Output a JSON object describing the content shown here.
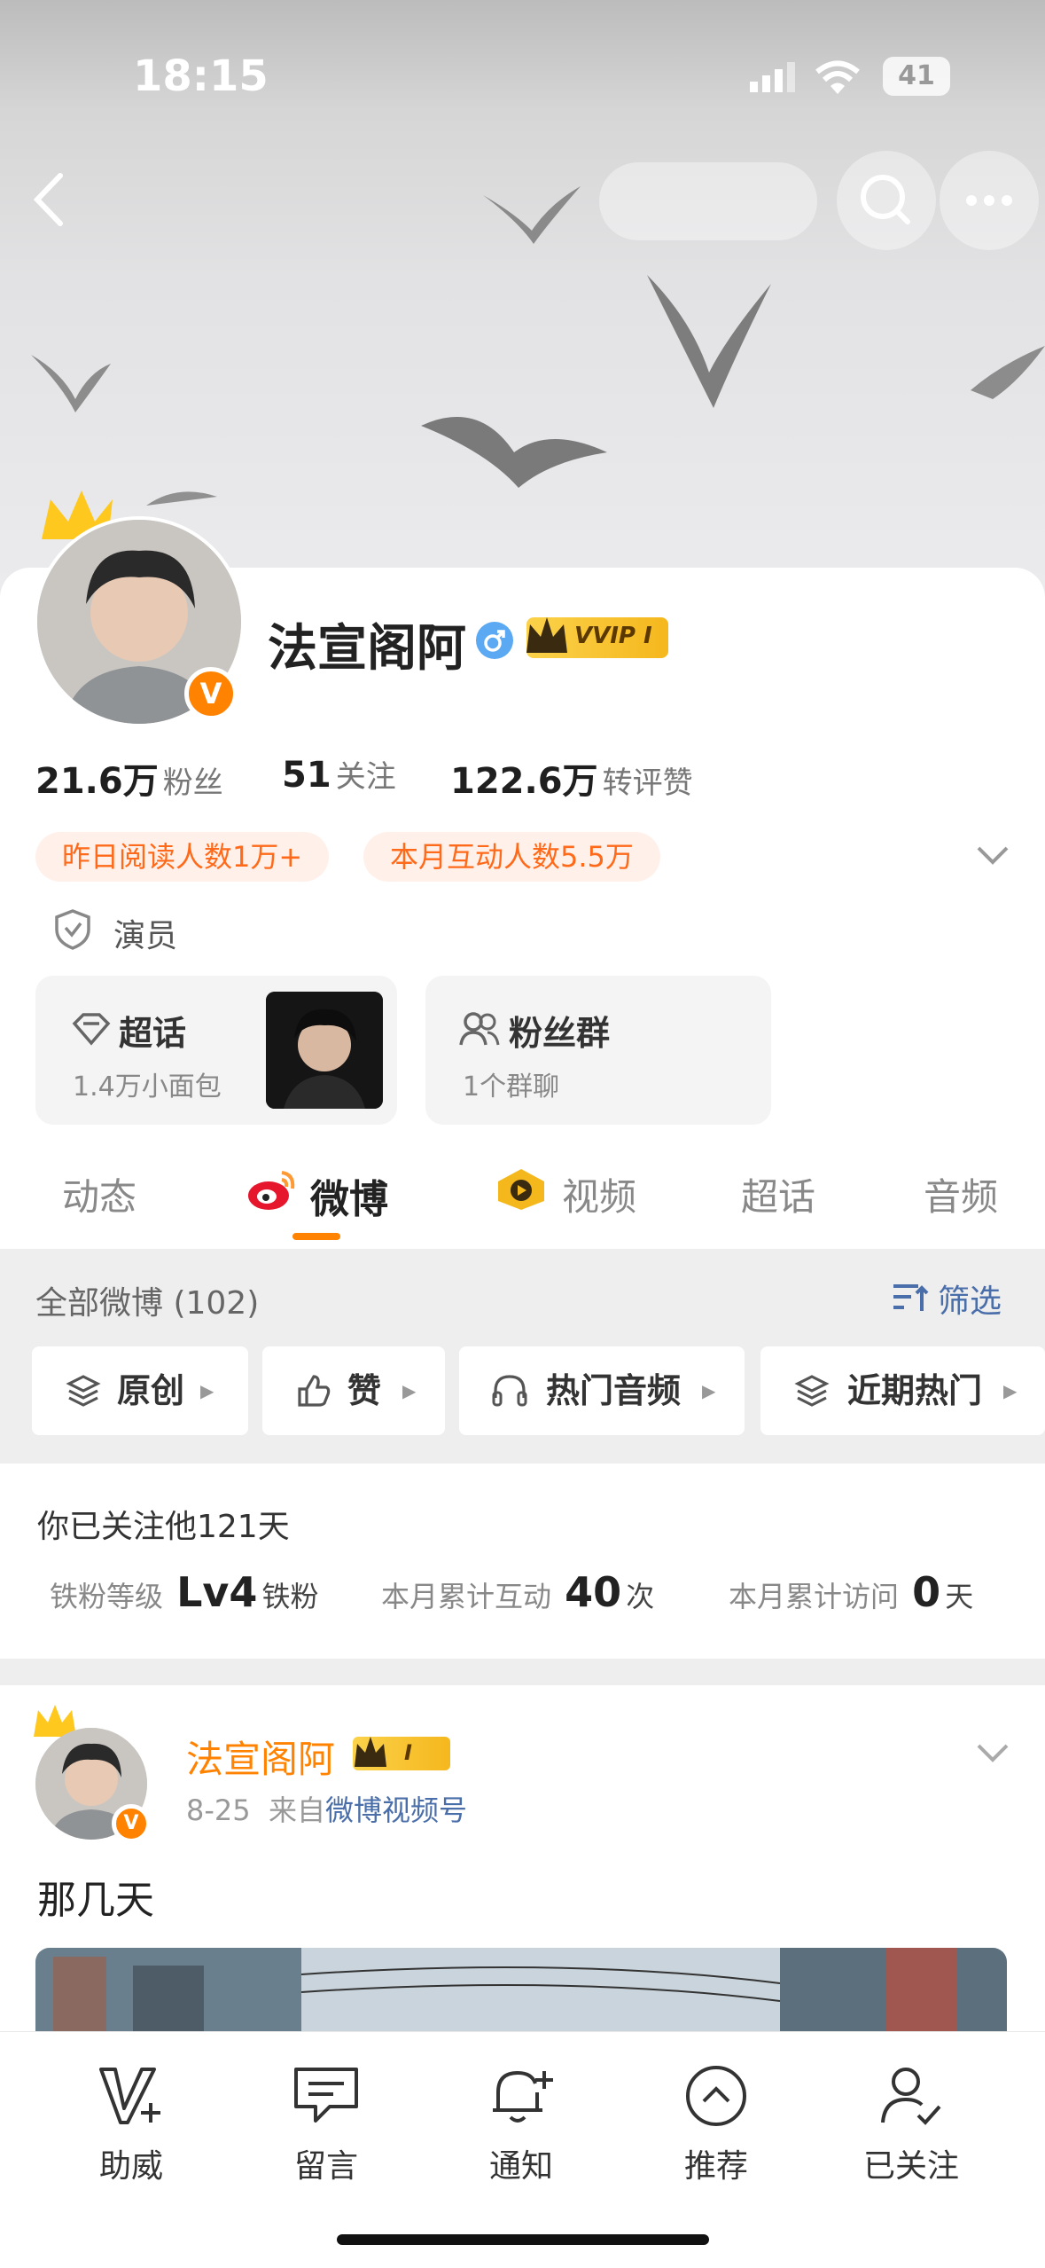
{
  "status_bar": {
    "time": "18:15",
    "battery": "41"
  },
  "profile": {
    "name": "法宣阁阿",
    "vip_badge": "VVIP I",
    "stats": [
      {
        "value": "21.6万",
        "label": "粉丝"
      },
      {
        "value": "51",
        "label": "关注"
      },
      {
        "value": "122.6万",
        "label": "转评赞"
      }
    ],
    "pills": [
      "昨日阅读人数1万+",
      "本月互动人数5.5万"
    ],
    "tag": "演员",
    "supertopic": {
      "title": "超话",
      "sub": "1.4万小面包"
    },
    "fan_group": {
      "title": "粉丝群",
      "sub": "1个群聊"
    }
  },
  "tabs": [
    {
      "label": "动态"
    },
    {
      "label": "微博"
    },
    {
      "label": "视频"
    },
    {
      "label": "超话"
    },
    {
      "label": "音频"
    }
  ],
  "filter": {
    "title": "全部微博 (102)",
    "filter_label": "筛选",
    "chips": [
      "原创",
      "赞",
      "热门音频",
      "近期热门"
    ]
  },
  "fan_info": {
    "follow_text": "你已关注他121天",
    "level_label": "铁粉等级",
    "level_value": "Lv4",
    "level_suffix": "铁粉",
    "interact_label": "本月累计互动",
    "interact_value": "40",
    "interact_unit": "次",
    "visit_label": "本月累计访问",
    "visit_value": "0",
    "visit_unit": "天"
  },
  "post": {
    "author": "法宣阁阿",
    "badge": "I",
    "date": "8-25",
    "source_prefix": "来自",
    "source": "微博视频号",
    "text": "那几天"
  },
  "bottom_nav": [
    {
      "label": "助威",
      "icon": "cheer-icon"
    },
    {
      "label": "留言",
      "icon": "message-icon"
    },
    {
      "label": "通知",
      "icon": "bell-plus-icon"
    },
    {
      "label": "推荐",
      "icon": "recommend-icon"
    },
    {
      "label": "已关注",
      "icon": "followed-user-icon"
    }
  ],
  "colors": {
    "accent": "#ff8200",
    "orange_text": "#ff6a1a",
    "link_blue": "#4a6ea9"
  }
}
